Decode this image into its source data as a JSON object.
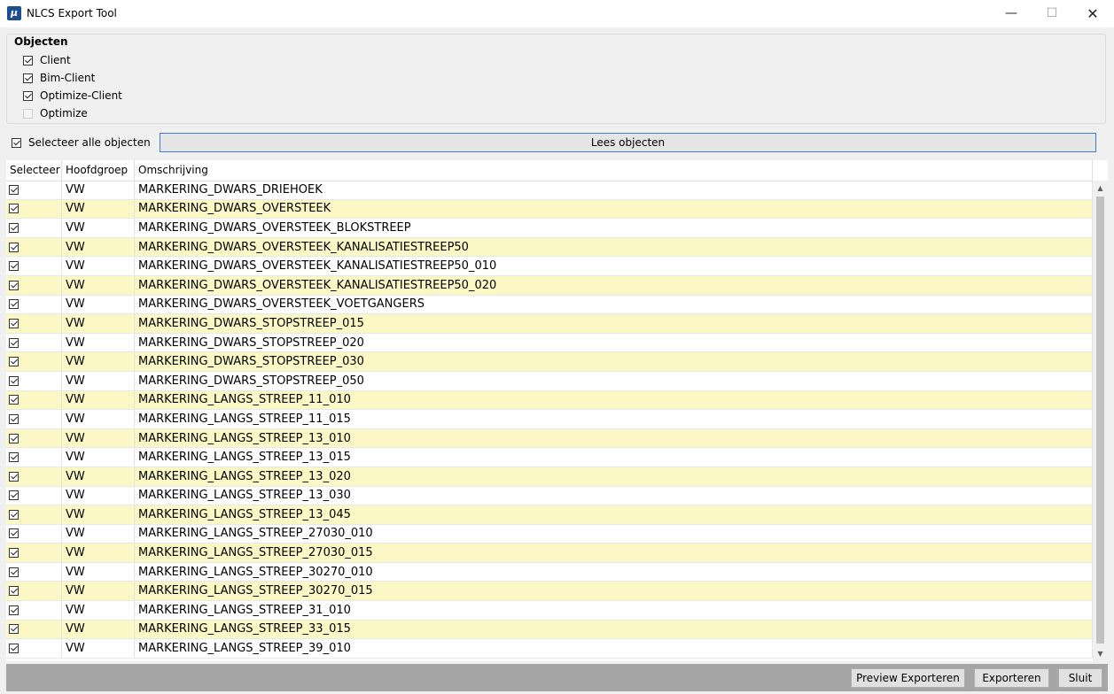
{
  "window": {
    "title": "NLCS Export Tool",
    "icon": "app-logo-icon"
  },
  "objecten": {
    "legend": "Objecten",
    "items": [
      {
        "label": "Client",
        "checked": true
      },
      {
        "label": "Bim-Client",
        "checked": true
      },
      {
        "label": "Optimize-Client",
        "checked": true
      },
      {
        "label": "Optimize",
        "checked": false,
        "disabled": true
      }
    ]
  },
  "select_all": {
    "label": "Selecteer alle objecten",
    "checked": true
  },
  "lees_button": "Lees objecten",
  "grid": {
    "columns": [
      "Selecteer",
      "Hoofdgroep",
      "Omschrijving"
    ],
    "alt_row_color": "#fbf8c6",
    "rows": [
      {
        "checked": true,
        "group": "VW",
        "desc": "MARKERING_DWARS_DRIEHOEK"
      },
      {
        "checked": true,
        "group": "VW",
        "desc": "MARKERING_DWARS_OVERSTEEK"
      },
      {
        "checked": true,
        "group": "VW",
        "desc": "MARKERING_DWARS_OVERSTEEK_BLOKSTREEP"
      },
      {
        "checked": true,
        "group": "VW",
        "desc": "MARKERING_DWARS_OVERSTEEK_KANALISATIESTREEP50"
      },
      {
        "checked": true,
        "group": "VW",
        "desc": "MARKERING_DWARS_OVERSTEEK_KANALISATIESTREEP50_010"
      },
      {
        "checked": true,
        "group": "VW",
        "desc": "MARKERING_DWARS_OVERSTEEK_KANALISATIESTREEP50_020"
      },
      {
        "checked": true,
        "group": "VW",
        "desc": "MARKERING_DWARS_OVERSTEEK_VOETGANGERS"
      },
      {
        "checked": true,
        "group": "VW",
        "desc": "MARKERING_DWARS_STOPSTREEP_015"
      },
      {
        "checked": true,
        "group": "VW",
        "desc": "MARKERING_DWARS_STOPSTREEP_020"
      },
      {
        "checked": true,
        "group": "VW",
        "desc": "MARKERING_DWARS_STOPSTREEP_030"
      },
      {
        "checked": true,
        "group": "VW",
        "desc": "MARKERING_DWARS_STOPSTREEP_050"
      },
      {
        "checked": true,
        "group": "VW",
        "desc": "MARKERING_LANGS_STREEP_11_010"
      },
      {
        "checked": true,
        "group": "VW",
        "desc": "MARKERING_LANGS_STREEP_11_015"
      },
      {
        "checked": true,
        "group": "VW",
        "desc": "MARKERING_LANGS_STREEP_13_010"
      },
      {
        "checked": true,
        "group": "VW",
        "desc": "MARKERING_LANGS_STREEP_13_015"
      },
      {
        "checked": true,
        "group": "VW",
        "desc": "MARKERING_LANGS_STREEP_13_020"
      },
      {
        "checked": true,
        "group": "VW",
        "desc": "MARKERING_LANGS_STREEP_13_030"
      },
      {
        "checked": true,
        "group": "VW",
        "desc": "MARKERING_LANGS_STREEP_13_045"
      },
      {
        "checked": true,
        "group": "VW",
        "desc": "MARKERING_LANGS_STREEP_27030_010"
      },
      {
        "checked": true,
        "group": "VW",
        "desc": "MARKERING_LANGS_STREEP_27030_015"
      },
      {
        "checked": true,
        "group": "VW",
        "desc": "MARKERING_LANGS_STREEP_30270_010"
      },
      {
        "checked": true,
        "group": "VW",
        "desc": "MARKERING_LANGS_STREEP_30270_015"
      },
      {
        "checked": true,
        "group": "VW",
        "desc": "MARKERING_LANGS_STREEP_31_010"
      },
      {
        "checked": true,
        "group": "VW",
        "desc": "MARKERING_LANGS_STREEP_33_015"
      },
      {
        "checked": true,
        "group": "VW",
        "desc": "MARKERING_LANGS_STREEP_39_010"
      }
    ]
  },
  "footer": {
    "preview_label": "Preview Exporteren",
    "export_label": "Exporteren",
    "close_label": "Sluit"
  }
}
